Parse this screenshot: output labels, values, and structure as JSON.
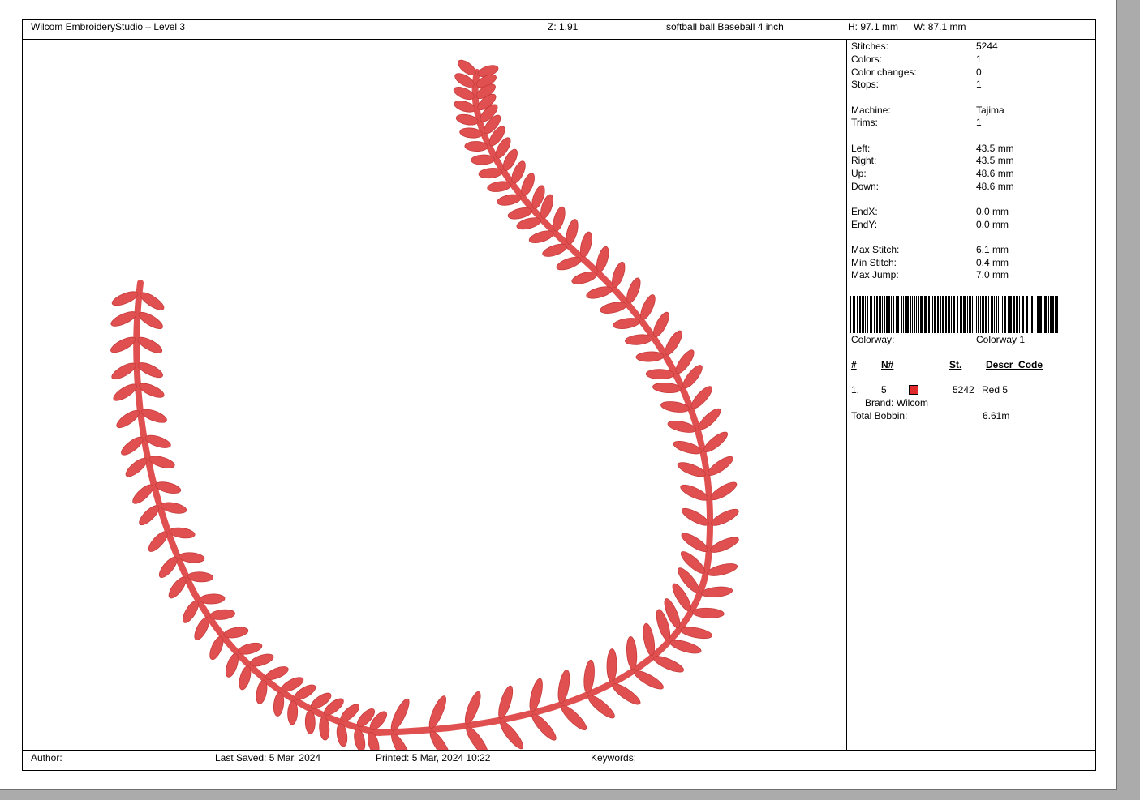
{
  "header": {
    "app": "Wilcom EmbroideryStudio – Level 3",
    "zoom": "Z: 1.91",
    "design_name": "softball ball  Baseball 4 inch",
    "height": "H: 97.1 mm",
    "width": "W: 87.1 mm"
  },
  "stats": [
    {
      "k": "Stitches:",
      "v": "5244"
    },
    {
      "k": "Colors:",
      "v": "1"
    },
    {
      "k": "Color changes:",
      "v": "0"
    },
    {
      "k": "Stops:",
      "v": "1"
    },
    {
      "k": "Machine:",
      "v": "Tajima"
    },
    {
      "k": "Trims:",
      "v": "1"
    },
    {
      "k": "Left:",
      "v": "43.5 mm"
    },
    {
      "k": "Right:",
      "v": "43.5 mm"
    },
    {
      "k": "Up:",
      "v": "48.6 mm"
    },
    {
      "k": "Down:",
      "v": "48.6 mm"
    },
    {
      "k": "EndX:",
      "v": "0.0 mm"
    },
    {
      "k": "EndY:",
      "v": "0.0 mm"
    },
    {
      "k": "Max Stitch:",
      "v": "6.1 mm"
    },
    {
      "k": "Min Stitch:",
      "v": "0.4 mm"
    },
    {
      "k": "Max Jump:",
      "v": "7.0 mm"
    }
  ],
  "colorway": {
    "label": "Colorway:",
    "value": "Colorway 1"
  },
  "table": {
    "headers": {
      "num": "#",
      "n": "N#",
      "st": "St.",
      "descr": "Descr_Code"
    },
    "rows": [
      {
        "num": "1.",
        "n": "5",
        "st": "5242",
        "descr": "Red 5",
        "color": "#e02a2a",
        "brand": "Brand: Wilcom"
      }
    ]
  },
  "bobbin": {
    "label": "Total Bobbin:",
    "value": "6.61m"
  },
  "footer": {
    "author": "Author:",
    "last_saved": "Last Saved:  5 Mar, 2024",
    "printed": "Printed:  5 Mar, 2024 10:22",
    "keywords": "Keywords:"
  },
  "colors": {
    "thread": "#e05050",
    "thread_dark": "#c73a3a"
  }
}
